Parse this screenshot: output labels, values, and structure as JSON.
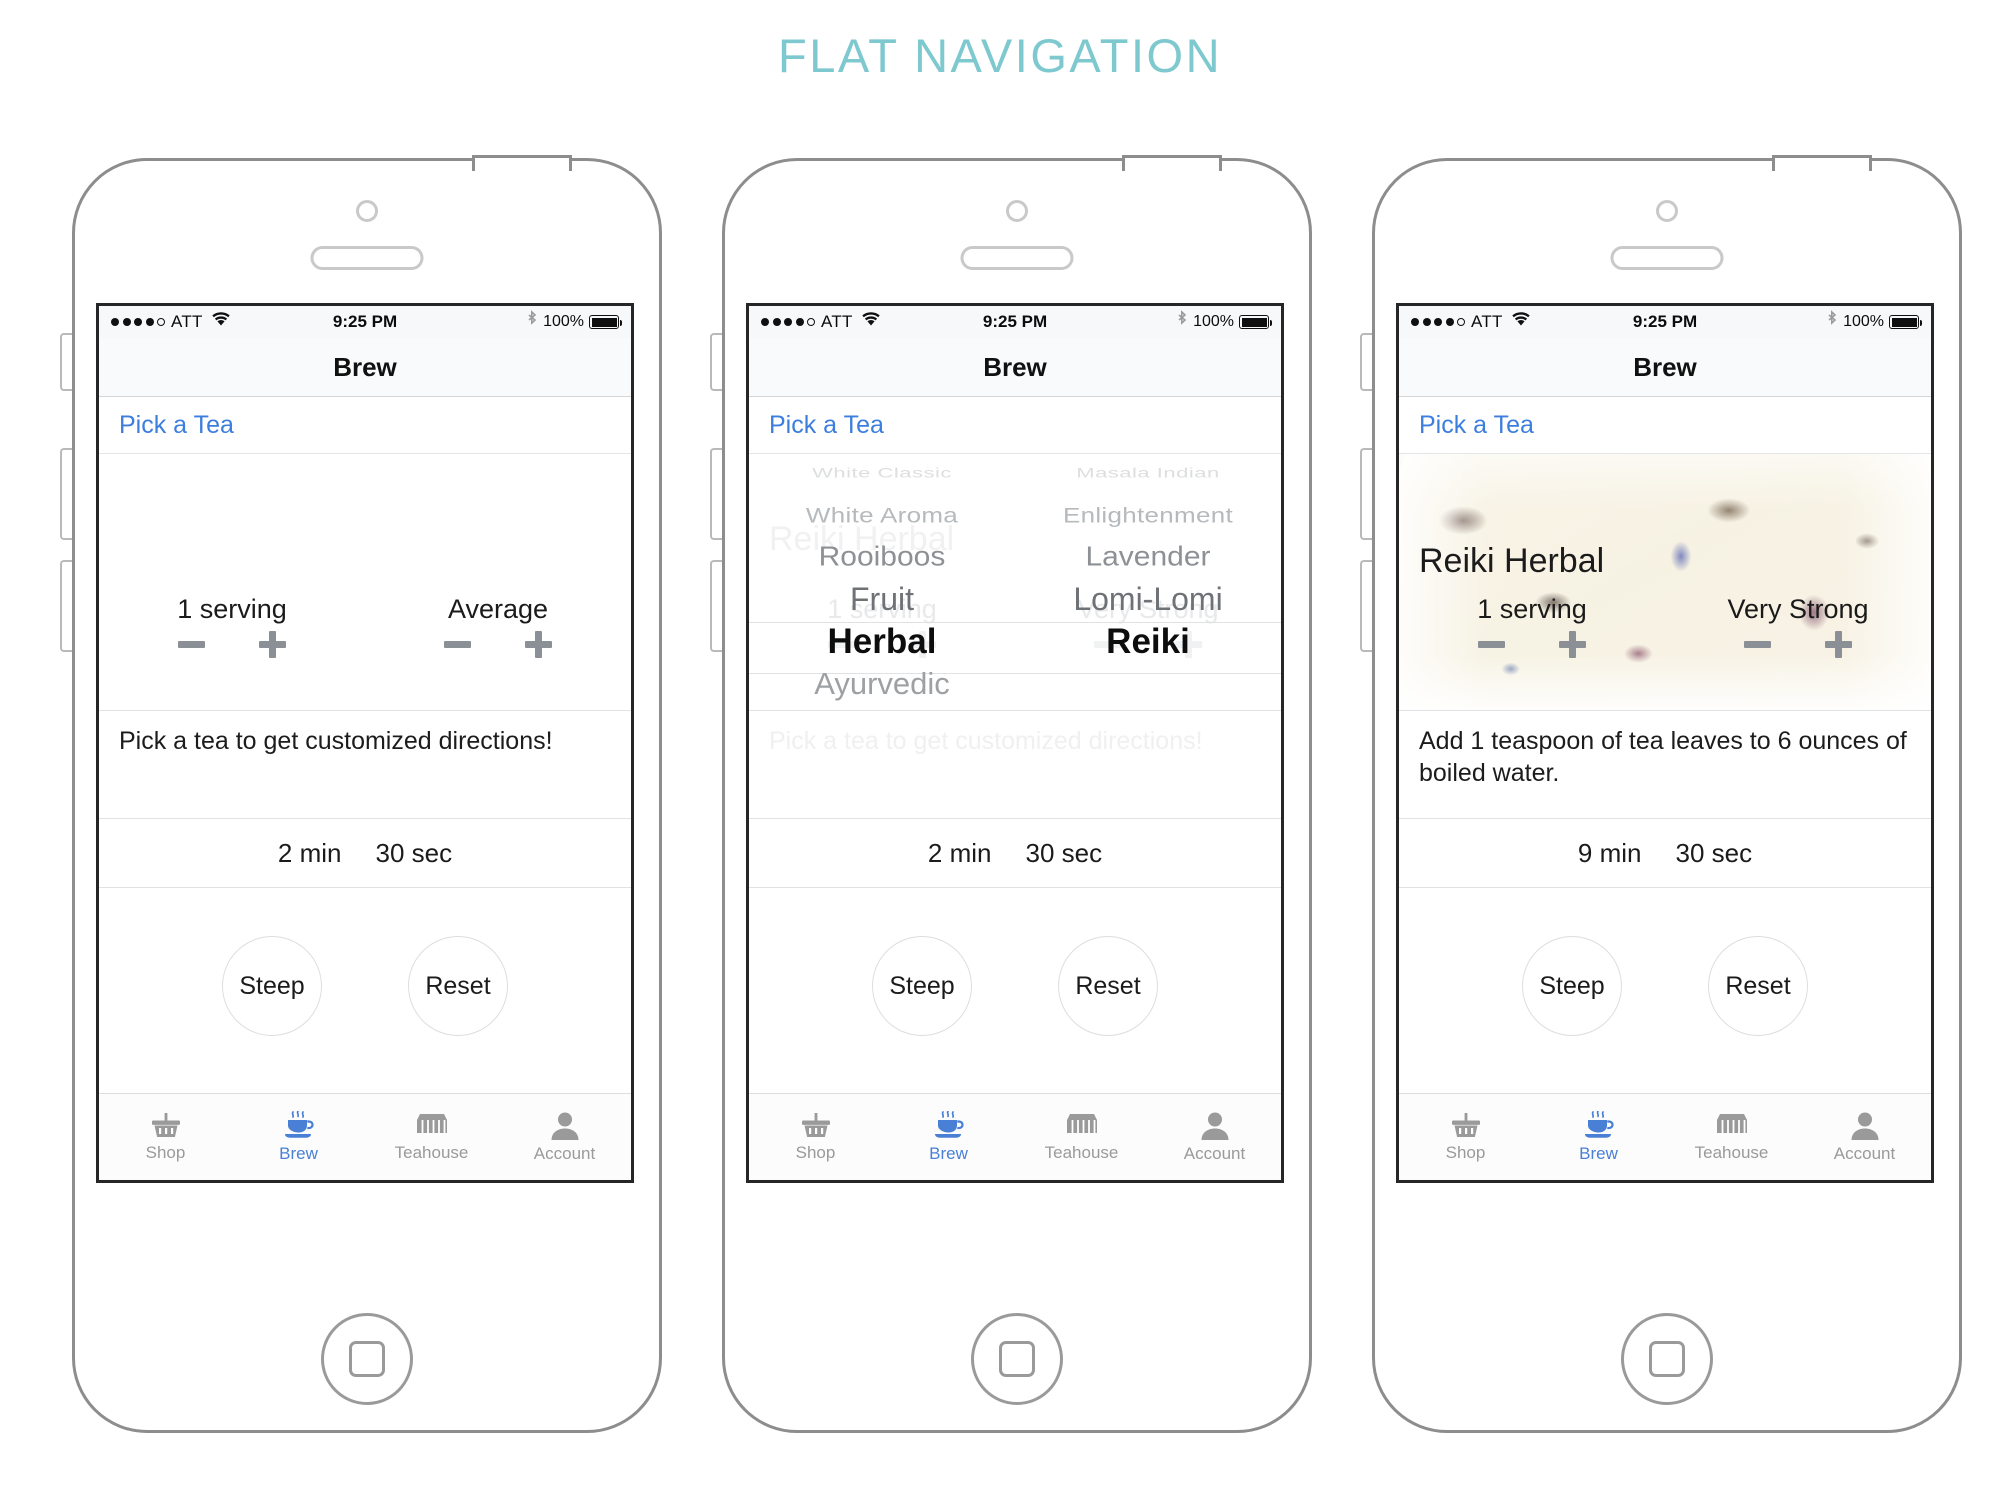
{
  "page": {
    "title": "FLAT NAVIGATION",
    "title_color": "#7ec9cf"
  },
  "status_bar": {
    "carrier": "ATT",
    "time": "9:25 PM",
    "battery_pct": "100%",
    "signal_dots_filled": 4,
    "signal_dots_total": 5,
    "icons": [
      "wifi-icon",
      "bluetooth-icon",
      "battery-icon"
    ]
  },
  "nav": {
    "title": "Brew",
    "pick_a_tea": "Pick a Tea",
    "link_color": "#3c7ede"
  },
  "tabs": [
    {
      "label": "Shop",
      "icon": "basket-icon",
      "active": false
    },
    {
      "label": "Brew",
      "icon": "teacup-icon",
      "active": true
    },
    {
      "label": "Teahouse",
      "icon": "storefront-icon",
      "active": false
    },
    {
      "label": "Account",
      "icon": "person-icon",
      "active": false
    }
  ],
  "buttons": {
    "steep": "Steep",
    "reset": "Reset",
    "minus": "minus-icon",
    "plus": "plus-icon"
  },
  "phone1": {
    "tea_name": "",
    "servings": "1 serving",
    "strength": "Average",
    "directions": "Pick a tea to get customized directions!",
    "timer_min": "2 min",
    "timer_sec": "30 sec"
  },
  "phone2": {
    "servings": "1 serving",
    "strength": "Very Strong",
    "tea_name_ghost": "Reiki Herbal",
    "directions": "Pick a tea to get customized directions!",
    "timer_min": "2 min",
    "timer_sec": "30 sec",
    "picker": {
      "left_column": [
        "White Classic",
        "White Aroma",
        "Rooiboos",
        "Fruit",
        "Herbal",
        "Ayurvedic"
      ],
      "left_selected": "Herbal",
      "right_column": [
        "Masala Indian",
        "Enlightenment",
        "Lavender",
        "Lomi-Lomi",
        "Reiki"
      ],
      "right_selected": "Reiki"
    }
  },
  "phone3": {
    "tea_name": "Reiki Herbal",
    "servings": "1 serving",
    "strength": "Very Strong",
    "directions": "Add 1 teaspoon of tea leaves to 6 ounces of boiled water.",
    "timer_min": "9 min",
    "timer_sec": "30 sec"
  }
}
